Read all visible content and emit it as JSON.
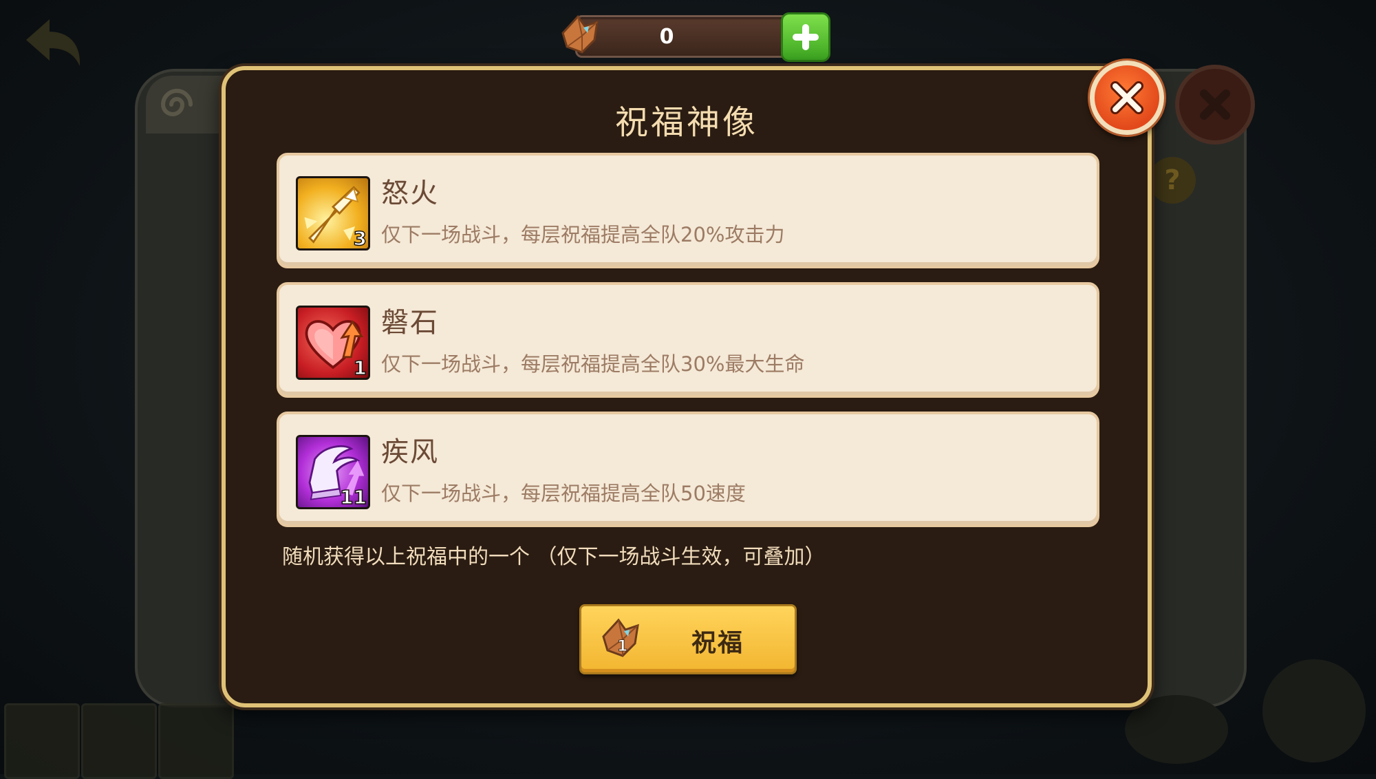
{
  "currency": {
    "amount": "0",
    "icon": "coupon-crystal-icon",
    "add_icon": "plus-icon"
  },
  "dialog": {
    "title": "祝福神像",
    "blessings": [
      {
        "name": "怒火",
        "description": "仅下一场战斗，每层祝福提高全队20%攻击力",
        "stack": "3",
        "icon": "sword-burst-icon",
        "color": "#f2b020"
      },
      {
        "name": "磐石",
        "description": "仅下一场战斗，每层祝福提高全队30%最大生命",
        "stack": "1",
        "icon": "heart-up-icon",
        "color": "#d22a2a"
      },
      {
        "name": "疾风",
        "description": "仅下一场战斗，每层祝福提高全队50速度",
        "stack": "11",
        "icon": "winged-boot-icon",
        "color": "#b22fd8"
      }
    ],
    "note": "随机获得以上祝福中的一个 （仅下一场战斗生效，可叠加）",
    "bless_button": {
      "label": "祝福",
      "cost": "1",
      "icon": "coupon-crystal-icon"
    }
  },
  "colors": {
    "accent_gold": "#e0c277",
    "close_orange": "#e2491b",
    "add_green": "#4ec42a"
  }
}
